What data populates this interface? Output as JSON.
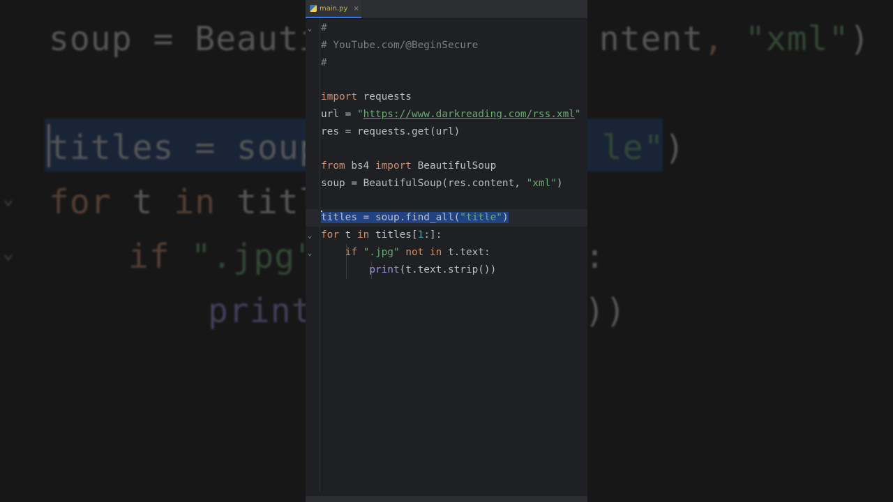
{
  "tab": {
    "label": "main.py",
    "close": "×"
  },
  "code": {
    "comment_hash": "#",
    "comment_youtube": "# YouTube.com/@BeginSecure",
    "kw_import": "import",
    "mod_requests": " requests",
    "url_var": "url = ",
    "quote": "\"",
    "url_value": "https://www.darkreading.com/rss.xml",
    "res_line": "res = requests.get(url)",
    "kw_from": "from",
    "mod_bs4": " bs4 ",
    "name_beautifulsoup": " BeautifulSoup",
    "soup_pre": "soup = BeautifulSoup(res.content, ",
    "str_xml": "\"xml\"",
    "close_paren": ")",
    "titles_pre": "titles = soup.find_all(",
    "str_title": "\"title\"",
    "kw_for": "for",
    "for_t": " t ",
    "kw_in": "in",
    "titles_ref": " titles[",
    "num_one": "1",
    "slice_end": ":]:",
    "indent1": "    ",
    "kw_if": "if",
    "space": " ",
    "str_jpg": "\".jpg\"",
    "kw_not": "not",
    "t_text": " t.text:",
    "indent2": "        ",
    "bi_print": "print",
    "print_args": "(t.text.strip())"
  },
  "background": {
    "line1_pre": "soup = Beauti",
    "line1_post_a": "ntent",
    "line1_comma": ", ",
    "line1_xml": "\"xml\"",
    "line1_paren": ")",
    "line2_pre": "titles = soup",
    "line2_str": "le\"",
    "line2_paren": ")",
    "line3_for": "for",
    "line3_t": " t ",
    "line3_in": "in",
    "line3_rest": " titl",
    "line4_if": "if",
    "line4_jpg": " \".jpg\"",
    "line4_colon": ":",
    "line5_print": "print",
    "line5_paren": "))",
    "chevron": "⌄"
  },
  "colors": {
    "keyword": "#cf8e6d",
    "string": "#6aab73",
    "comment": "#7a7e85",
    "number": "#2aacb8",
    "builtin": "#9b8fdc",
    "selection": "#214283"
  }
}
